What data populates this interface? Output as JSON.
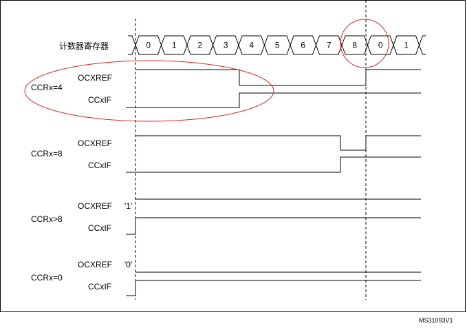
{
  "counter_label": "计数器寄存器",
  "counter_values": [
    "0",
    "1",
    "2",
    "3",
    "4",
    "5",
    "6",
    "7",
    "8",
    "0",
    "1"
  ],
  "signal_names": {
    "ref": "OCXREF",
    "flag": "CCxIF"
  },
  "cases": [
    {
      "label": "CCRx=4",
      "compare": 4,
      "ref_mode": "compare"
    },
    {
      "label": "CCRx=8",
      "compare": 8,
      "ref_mode": "compare"
    },
    {
      "label": "CCRx>8",
      "compare": null,
      "ref_mode": "forced_high",
      "forced_value": "'1'"
    },
    {
      "label": "CCRx=0",
      "compare": 0,
      "ref_mode": "forced_low",
      "forced_value": "'0'"
    }
  ],
  "figure_id": "MS31093V1",
  "highlight_color": "#d9281f"
}
